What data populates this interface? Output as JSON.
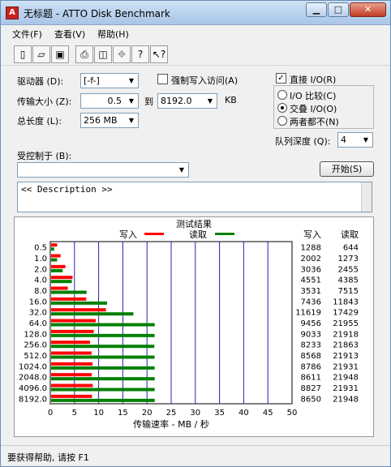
{
  "window": {
    "title": "无标题 - ATTO Disk Benchmark",
    "icon_text": "A"
  },
  "caption": {
    "min": "▁",
    "max": "□",
    "close": "✕"
  },
  "menus": [
    "文件(F)",
    "查看(V)",
    "帮助(H)"
  ],
  "toolbar": [
    "new-icon",
    "open-icon",
    "save-icon",
    "print-icon",
    "print-preview-icon",
    "move-icon",
    "help-icon",
    "context-help-icon"
  ],
  "toolbar_glyphs": [
    "▯",
    "▱",
    "▣",
    "⎙",
    "◫",
    "✥",
    "?",
    "↖?"
  ],
  "form": {
    "drive_label": "驱动器 (D):",
    "drive_value": "[-f-]",
    "force_write_label": "强制写入访问(A)",
    "transfer_label": "传输大小 (Z):",
    "transfer_from": "0.5",
    "to_label": "到",
    "transfer_to": "8192.0",
    "kb_label": "KB",
    "total_label": "总长度 (L):",
    "total_value": "256 MB",
    "direct_io_label": "直接 I/O(R)",
    "io_options": [
      "I/O 比较(C)",
      "交叠 I/O(O)",
      "两者都不(N)"
    ],
    "io_selected": 1,
    "queue_label": "队列深度 (Q):",
    "queue_value": "4",
    "controlled_label": "受控制于 (B):",
    "controlled_value": "",
    "start_button": "开始(S)",
    "description": "<< Description >>"
  },
  "chart_data": {
    "type": "bar",
    "title": "测试结果",
    "legend": [
      {
        "name": "写入",
        "color": "#ff0000"
      },
      {
        "name": "读取",
        "color": "#008000"
      }
    ],
    "xlabel": "传输速率 - MB / 秒",
    "xlim": [
      0,
      50
    ],
    "xticks": [
      "0",
      "5",
      "10",
      "15",
      "20",
      "25",
      "30",
      "35",
      "40",
      "45",
      "50"
    ],
    "grid": true,
    "categories": [
      "0.5",
      "1.0",
      "2.0",
      "4.0",
      "8.0",
      "16.0",
      "32.0",
      "64.0",
      "128.0",
      "256.0",
      "512.0",
      "1024.0",
      "2048.0",
      "4096.0",
      "8192.0"
    ],
    "column_headers": [
      "写入",
      "读取"
    ],
    "write": [
      1288,
      2002,
      3036,
      4551,
      3531,
      7436,
      11619,
      9456,
      9033,
      8233,
      8568,
      8786,
      8611,
      8827,
      8650
    ],
    "read": [
      644,
      1273,
      2455,
      4385,
      7515,
      11843,
      17429,
      21955,
      21918,
      21863,
      21913,
      21931,
      21948,
      21931,
      21948
    ]
  },
  "status_text": "要获得帮助, 请按 F1"
}
